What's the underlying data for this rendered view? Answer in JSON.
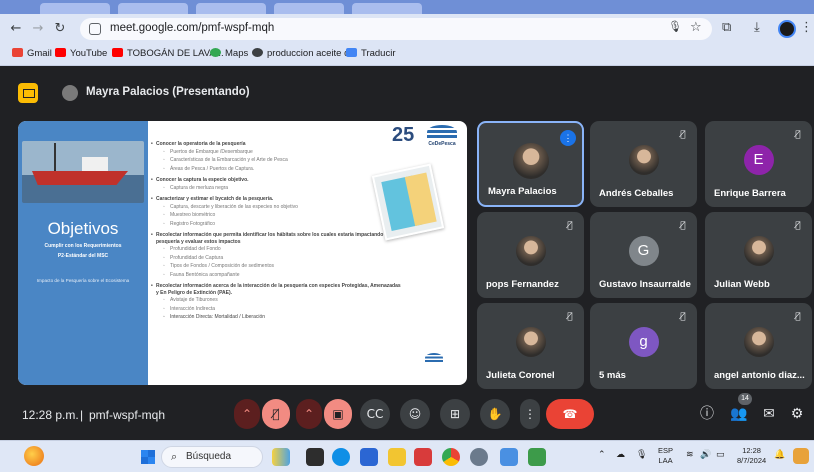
{
  "browser": {
    "url": "meet.google.com/pmf-wspf-mqh",
    "bookmarks": [
      "Gmail",
      "YouTube",
      "TOBOGÁN DE LAVA...",
      "Maps",
      "produccion aceite d...",
      "Traducir"
    ]
  },
  "meet": {
    "presenter_title": "Mayra Palacios (Presentando)",
    "time": "12:28 p.m.",
    "separator": "|",
    "meeting_code": "pmf-wspf-mqh",
    "participants_badge": "14",
    "participants": [
      {
        "name": "Mayra Palacios",
        "avatar_letter": "",
        "avatar_color": "#5f6368",
        "speaking": true
      },
      {
        "name": "Andrés Ceballes",
        "avatar_letter": "",
        "avatar_color": "#6b5a4b",
        "speaking": false
      },
      {
        "name": "Enrique Barrera",
        "avatar_letter": "E",
        "avatar_color": "#8e24aa",
        "speaking": false
      },
      {
        "name": "pops Fernandez",
        "avatar_letter": "",
        "avatar_color": "#c48a3a",
        "speaking": false
      },
      {
        "name": "Gustavo Insaurralde",
        "avatar_letter": "G",
        "avatar_color": "#80868b",
        "speaking": false
      },
      {
        "name": "Julian Webb",
        "avatar_letter": "",
        "avatar_color": "#d93025",
        "speaking": false
      },
      {
        "name": "Julieta Coronel",
        "avatar_letter": "",
        "avatar_color": "#b5651d",
        "speaking": false
      },
      {
        "name": "5 más",
        "avatar_letter": "g",
        "avatar_color": "#7e57c2",
        "speaking": false
      },
      {
        "name": "angel antonio diaz...",
        "avatar_letter": "",
        "avatar_color": "#1565c0",
        "speaking": false
      }
    ]
  },
  "slide": {
    "title": "Objetivos",
    "subtitle_1": "Cumplir con los Requerimientos",
    "subtitle_2": "P2-Estándar del MSC",
    "impact": "Impacto de la Pesquería sobre el Ecosistema",
    "logo_25": "25",
    "logo_org": "CeDePesca",
    "sections": [
      {
        "heading": "Conocer la operatoria de la pesquería",
        "items": [
          "Puertos de Embarque /Desembarque",
          "Características de la Embarcación y el Arte de Pesca",
          "Áreas de Pesca / Puertos de Captura."
        ]
      },
      {
        "heading": "Conocer la captura la especie objetivo.",
        "items": [
          "Captura de merluza negra"
        ]
      },
      {
        "heading": "Caracterizar y estimar el bycatch de la pesquería.",
        "items": [
          "Captura, descarte y liberación de las especies no objetivo",
          "Muestreo biométrico",
          "Registro Fotográfico"
        ]
      },
      {
        "heading": "Recolectar información que permita identificar los hábitats sobre los cuales estaría impactando la pesquería y evaluar estos impactos",
        "items": [
          "Profundidad del Fondo",
          "Profundidad de Captura",
          "Tipos de Fondos / Composición de sedimentos",
          "Fauna Bentónica acompañante"
        ]
      },
      {
        "heading": "Recolectar información acerca de la interacción de la pesquería con especies Protegidas, Amenazadas y En Peligro de Extinción (PAE).",
        "items": [
          "Avistaje de Tiburones",
          "Interacción Indirecta",
          "Interacción Directa: Mortalidad / Liberación"
        ]
      }
    ]
  },
  "taskbar": {
    "search_placeholder": "Búsqueda",
    "lang_1": "ESP",
    "lang_2": "LAA",
    "clock_time": "12:28",
    "clock_date": "8/7/2024"
  }
}
